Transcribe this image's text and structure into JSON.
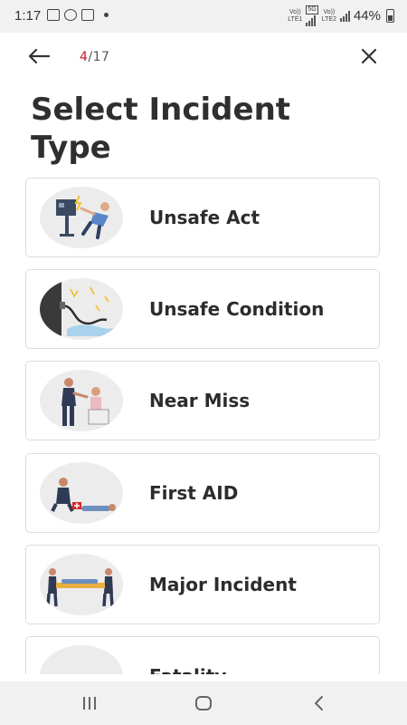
{
  "status_bar": {
    "time": "1:17",
    "net1_top": "Vo))",
    "net1_bottom": "LTE1",
    "net_5g": "5G",
    "net2_top": "Vo))",
    "net2_bottom": "LTE2",
    "battery": "44%"
  },
  "header": {
    "progress_current": "4",
    "progress_total": "/17"
  },
  "title": "Select Incident Type",
  "incident_types": [
    {
      "label": "Unsafe Act",
      "icon": "electric-shock-illustration"
    },
    {
      "label": "Unsafe Condition",
      "icon": "electrical-hazard-illustration"
    },
    {
      "label": "Near Miss",
      "icon": "medical-assist-illustration"
    },
    {
      "label": "First AID",
      "icon": "first-aid-illustration"
    },
    {
      "label": "Major Incident",
      "icon": "stretcher-illustration"
    },
    {
      "label": "Fatality",
      "icon": "fatality-illustration"
    }
  ],
  "colors": {
    "accent": "#c8102e",
    "card_border": "#dddddd",
    "thumb_bg": "#ececec"
  }
}
